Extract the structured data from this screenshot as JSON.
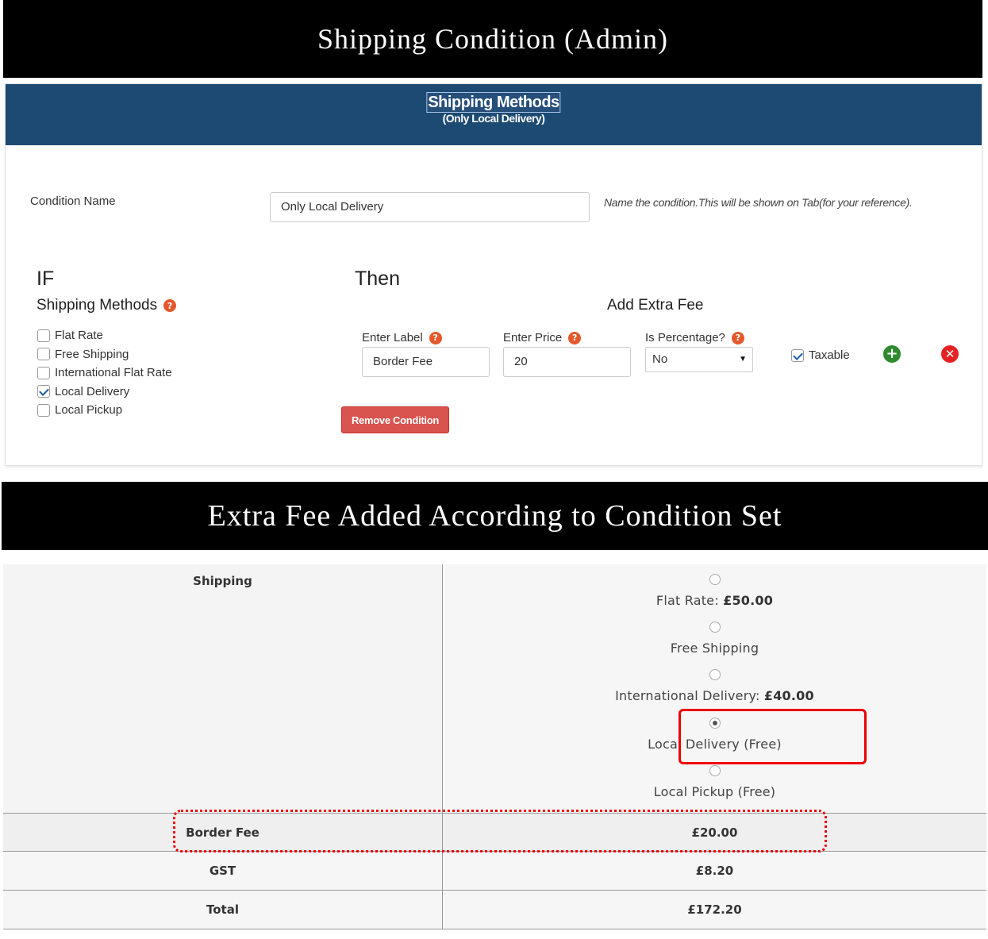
{
  "banners": {
    "top": "Shipping Condition (Admin)",
    "middle": "Extra Fee Added According to Condition Set"
  },
  "panel": {
    "title": "Shipping Methods",
    "subtitle": "(Only Local Delivery)",
    "condition_name_label": "Condition Name",
    "condition_name_value": "Only Local Delivery",
    "condition_name_hint": "Name the condition.This will be shown on Tab(for your reference).",
    "if_heading": "IF",
    "then_heading": "Then",
    "shipping_methods_heading": "Shipping Methods",
    "add_extra_fee_heading": "Add Extra Fee",
    "methods": [
      {
        "label": "Flat Rate",
        "checked": false
      },
      {
        "label": "Free Shipping",
        "checked": false
      },
      {
        "label": "International Flat Rate",
        "checked": false
      },
      {
        "label": "Local Delivery",
        "checked": true
      },
      {
        "label": "Local Pickup",
        "checked": false
      }
    ],
    "fee": {
      "label_caption": "Enter Label",
      "label_value": "Border Fee",
      "price_caption": "Enter Price",
      "price_value": "20",
      "percentage_caption": "Is Percentage?",
      "percentage_value": "No",
      "taxable_label": "Taxable",
      "taxable_checked": true
    },
    "remove_button": "Remove Condition",
    "help_icon_glyph": "?",
    "add_icon_glyph": "+",
    "remove_icon_glyph": "✕",
    "header_color": "#1c4a72",
    "remove_button_color": "#d9534f"
  },
  "cart": {
    "shipping_label": "Shipping",
    "options": [
      {
        "name": "Flat Rate:",
        "price": "£50.00",
        "selected": false
      },
      {
        "name": "Free Shipping",
        "price": "",
        "selected": false
      },
      {
        "name": "International Delivery:",
        "price": "£40.00",
        "selected": false
      },
      {
        "name": "Local Delivery (Free)",
        "price": "",
        "selected": true
      },
      {
        "name": "Local Pickup (Free)",
        "price": "",
        "selected": false
      }
    ],
    "fee_label": "Border Fee",
    "fee_value": "£20.00",
    "gst_label": "GST",
    "gst_value": "£8.20",
    "total_label": "Total",
    "total_value": "£172.20",
    "highlight_color": "#e00000"
  }
}
